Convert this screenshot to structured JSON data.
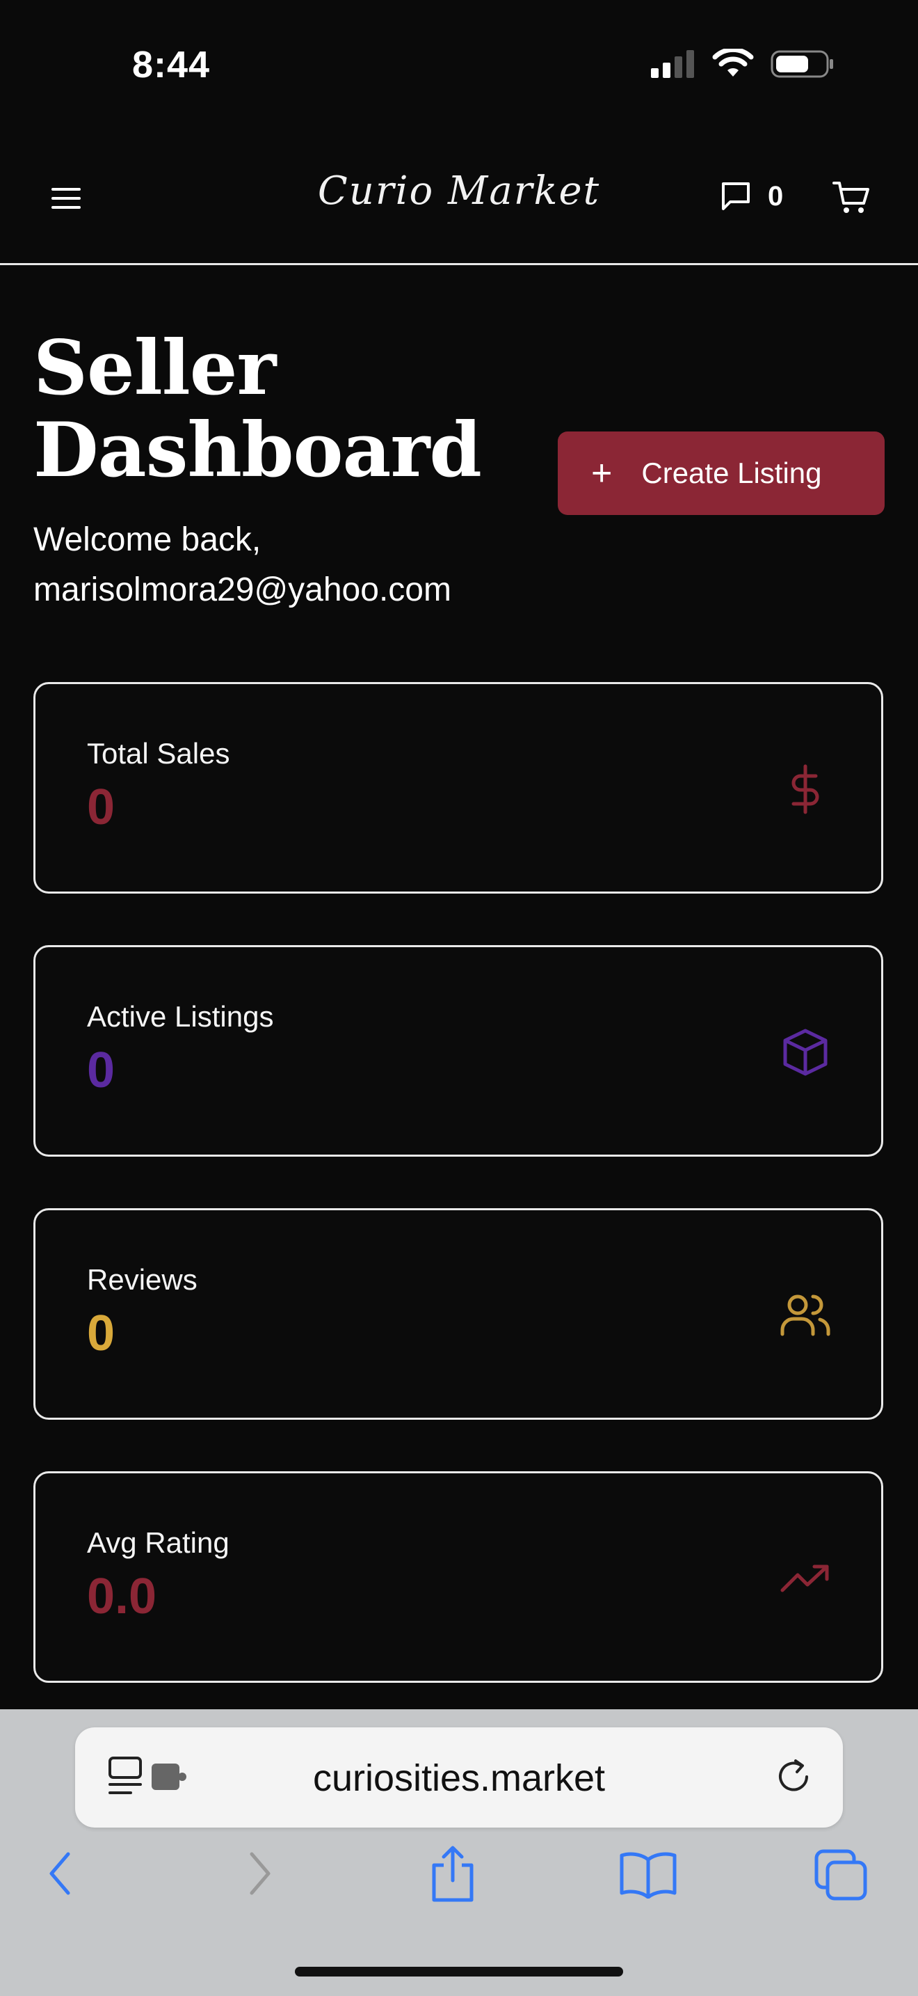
{
  "status_bar": {
    "time": "8:44"
  },
  "header": {
    "brand": "Curio Market",
    "messages_count": "0"
  },
  "page": {
    "title_line1": "Seller",
    "title_line2": "Dashboard",
    "welcome_prefix": "Welcome back,",
    "user_email": "marisolmora29@yahoo.com",
    "create_button": {
      "icon": "+",
      "label": "Create Listing"
    }
  },
  "stats": [
    {
      "label": "Total Sales",
      "value": "0",
      "icon": "dollar-icon",
      "color": "#8b2635"
    },
    {
      "label": "Active Listings",
      "value": "0",
      "icon": "package-icon",
      "color": "#5b2aa0"
    },
    {
      "label": "Reviews",
      "value": "0",
      "icon": "users-icon",
      "color": "#d9a93a"
    },
    {
      "label": "Avg Rating",
      "value": "0.0",
      "icon": "trending-up-icon",
      "color": "#8b2635"
    }
  ],
  "browser": {
    "url": "curiosities.market"
  },
  "colors": {
    "accent": "#8b2635",
    "background": "#0a0a0a",
    "browser_chrome": "#c5c7c9",
    "link_blue": "#3478f6"
  }
}
